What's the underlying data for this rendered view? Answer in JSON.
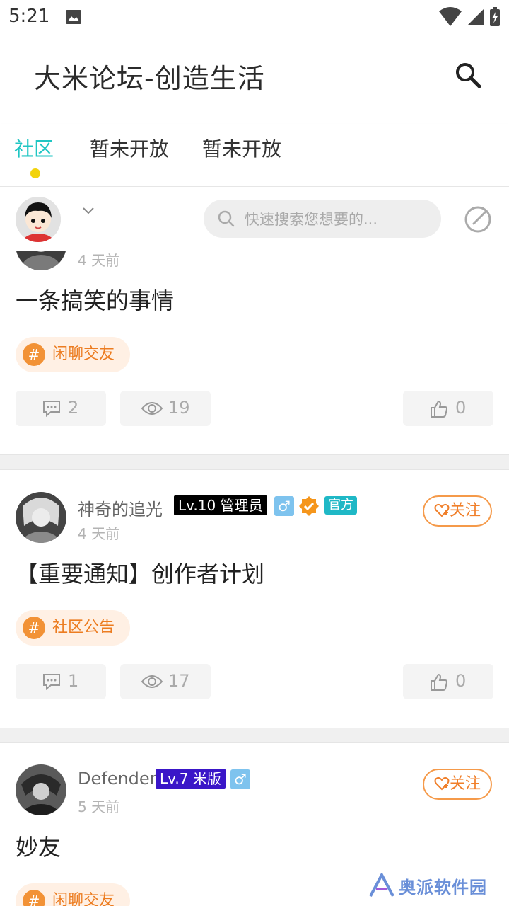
{
  "status_bar": {
    "time": "5:21"
  },
  "app_bar": {
    "title": "大米论坛-创造生活"
  },
  "tabs": [
    {
      "label": "社区",
      "active": true
    },
    {
      "label": "暂未开放",
      "active": false
    },
    {
      "label": "暂未开放",
      "active": false
    }
  ],
  "sub_bar": {
    "search_placeholder": "快速搜索您想要的..."
  },
  "posts": [
    {
      "time": "4 天前",
      "title": "一条搞笑的事情",
      "tag": "闲聊交友",
      "comments": "2",
      "views": "19",
      "likes": "0"
    },
    {
      "username": "神奇的追光",
      "level": "Lv.10 管理员",
      "gender_symbol": "♂",
      "official": "官方",
      "follow": "关注",
      "time": "4 天前",
      "title": "【重要通知】创作者计划",
      "tag": "社区公告",
      "comments": "1",
      "views": "17",
      "likes": "0"
    },
    {
      "username": "Defender",
      "level": "Lv.7 米版",
      "gender_symbol": "♂",
      "follow": "关注",
      "time": "5 天前",
      "title": "妙友",
      "tag": "闲聊交友"
    }
  ],
  "watermark": "奥派软件园",
  "colors": {
    "accent": "#1fc6c3",
    "tab_dot": "#f2d30b",
    "follow": "#f07f2a",
    "tag_bg": "#fff0e4",
    "admin_level_bg": "#000000",
    "member_level_bg": "#3a16c8"
  }
}
